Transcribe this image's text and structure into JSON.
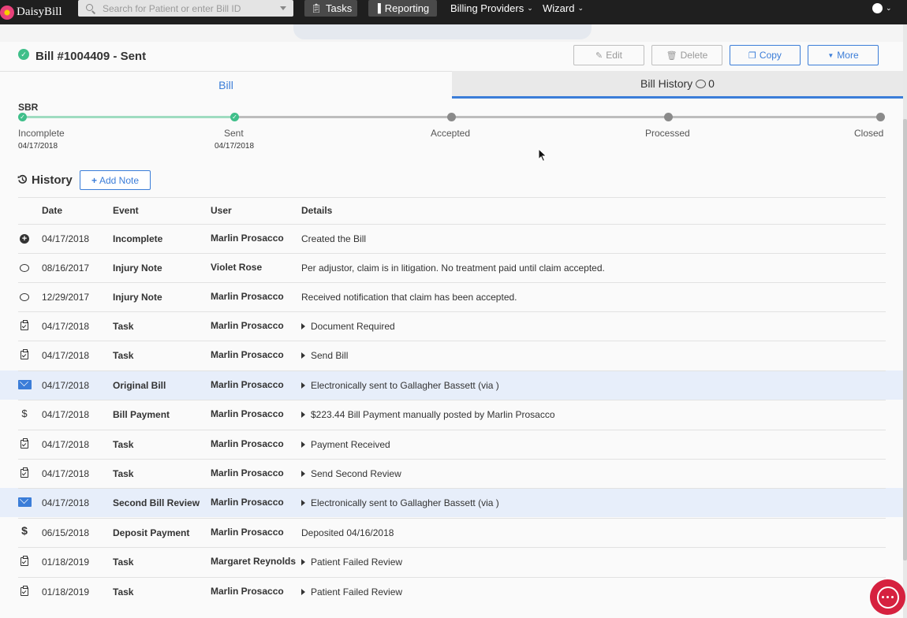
{
  "navbar": {
    "brand": "DaisyBill",
    "search_placeholder": "Search for Patient or enter Bill ID",
    "tasks_label": "Tasks",
    "reporting_label": "Reporting",
    "billing_providers_label": "Billing Providers",
    "wizard_label": "Wizard"
  },
  "bill": {
    "title": "Bill #1004409 - Sent",
    "edit_label": "Edit",
    "delete_label": "Delete",
    "copy_label": "Copy",
    "more_label": "More"
  },
  "tabs": {
    "bill_label": "Bill",
    "history_label": "Bill History",
    "history_count": "0"
  },
  "progress": {
    "form_type": "SBR",
    "stages": [
      {
        "label": "Incomplete",
        "date": "04/17/2018",
        "done": true
      },
      {
        "label": "Sent",
        "date": "04/17/2018",
        "done": true
      },
      {
        "label": "Accepted",
        "date": "",
        "done": false
      },
      {
        "label": "Processed",
        "date": "",
        "done": false
      },
      {
        "label": "Closed",
        "date": "",
        "done": false
      }
    ]
  },
  "history": {
    "title": "History",
    "add_note_label": "Add Note",
    "columns": {
      "date": "Date",
      "event": "Event",
      "user": "User",
      "details": "Details"
    },
    "rows": [
      {
        "icon": "plus-circle-icon",
        "date": "04/17/2018",
        "event": "Incomplete",
        "user": "Marlin Prosacco",
        "details": "Created the Bill",
        "expandable": false,
        "highlight": false
      },
      {
        "icon": "comment-icon",
        "date": "08/16/2017",
        "event": "Injury Note",
        "user": "Violet Rose",
        "details": "Per adjustor, claim is in litigation. No treatment paid until claim accepted.",
        "expandable": false,
        "highlight": false
      },
      {
        "icon": "comment-icon",
        "date": "12/29/2017",
        "event": "Injury Note",
        "user": "Marlin Prosacco",
        "details": "Received notification that claim has been accepted.",
        "expandable": false,
        "highlight": false
      },
      {
        "icon": "clipboard-check-icon",
        "date": "04/17/2018",
        "event": "Task",
        "user": "Marlin Prosacco",
        "details": "Document Required",
        "expandable": true,
        "highlight": false
      },
      {
        "icon": "clipboard-check-icon",
        "date": "04/17/2018",
        "event": "Task",
        "user": "Marlin Prosacco",
        "details": "Send Bill",
        "expandable": true,
        "highlight": false
      },
      {
        "icon": "envelope-icon",
        "date": "04/17/2018",
        "event": "Original Bill",
        "user": "Marlin Prosacco",
        "details": "Electronically sent to Gallagher Bassett (via )",
        "expandable": true,
        "highlight": true
      },
      {
        "icon": "dollar-icon",
        "date": "04/17/2018",
        "event": "Bill Payment",
        "user": "Marlin Prosacco",
        "details": "$223.44 Bill Payment manually posted by Marlin Prosacco",
        "expandable": true,
        "highlight": false
      },
      {
        "icon": "clipboard-check-icon",
        "date": "04/17/2018",
        "event": "Task",
        "user": "Marlin Prosacco",
        "details": "Payment Received",
        "expandable": true,
        "highlight": false
      },
      {
        "icon": "clipboard-check-icon",
        "date": "04/17/2018",
        "event": "Task",
        "user": "Marlin Prosacco",
        "details": "Send Second Review",
        "expandable": true,
        "highlight": false
      },
      {
        "icon": "envelope-icon",
        "date": "04/17/2018",
        "event": "Second Bill Review",
        "user": "Marlin Prosacco",
        "details": "Electronically sent to Gallagher Bassett (via )",
        "expandable": true,
        "highlight": true
      },
      {
        "icon": "deposit-icon",
        "date": "06/15/2018",
        "event": "Deposit Payment",
        "user": "Marlin Prosacco",
        "details": "Deposited 04/16/2018",
        "expandable": false,
        "highlight": false
      },
      {
        "icon": "clipboard-check-icon",
        "date": "01/18/2019",
        "event": "Task",
        "user": "Margaret Reynolds",
        "details": "Patient Failed Review",
        "expandable": true,
        "highlight": false
      },
      {
        "icon": "clipboard-check-icon",
        "date": "01/18/2019",
        "event": "Task",
        "user": "Marlin Prosacco",
        "details": "Patient Failed Review",
        "expandable": true,
        "highlight": false
      }
    ]
  },
  "colors": {
    "accent": "#3b7dd8",
    "success": "#3fbf8a",
    "navbar": "#1f1f1f",
    "highlight_row": "#e7eefa",
    "chat": "#d6213f"
  }
}
